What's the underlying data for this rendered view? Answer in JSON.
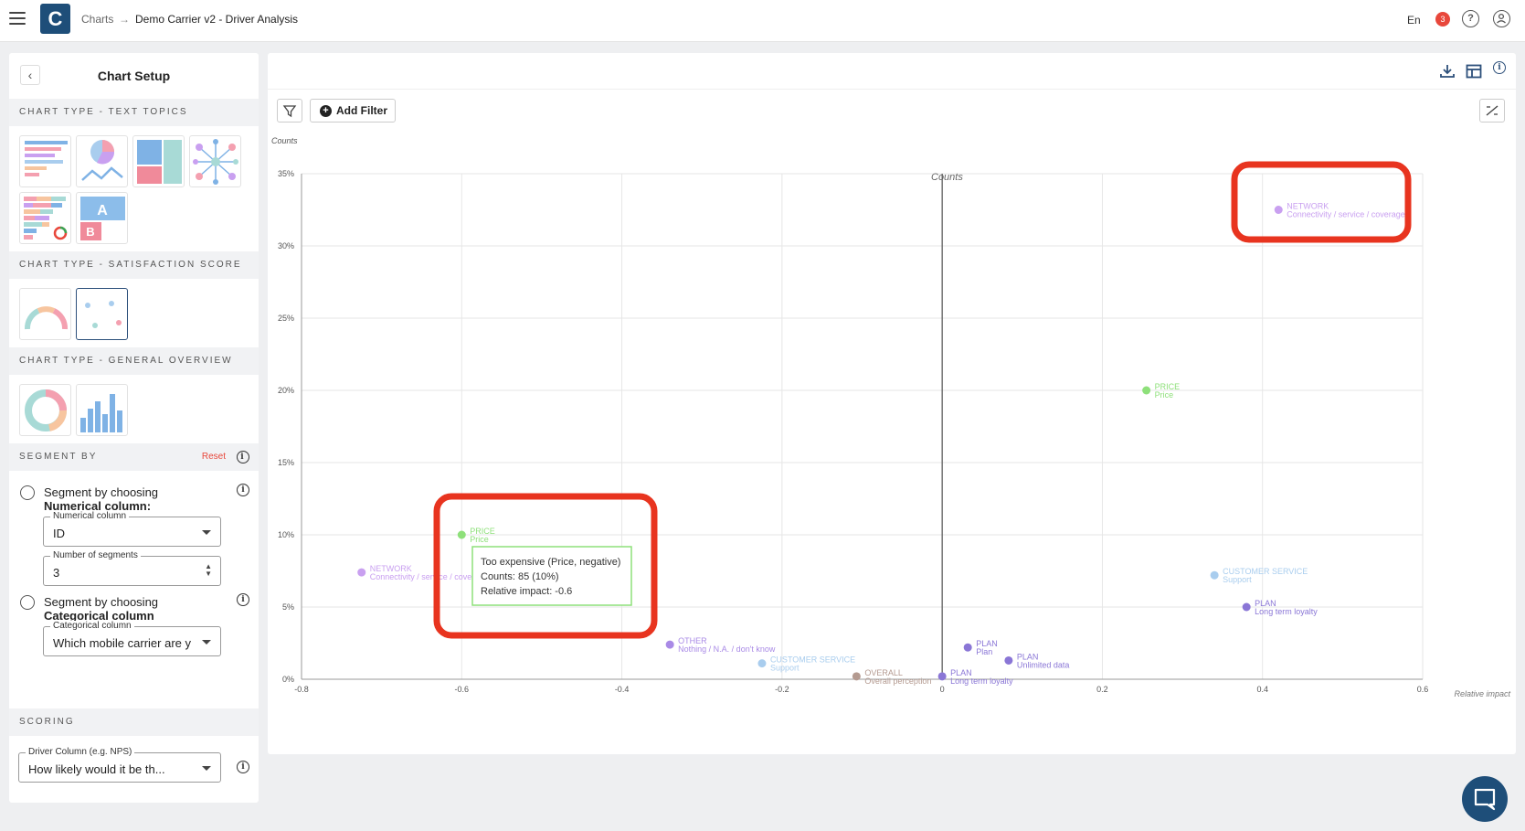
{
  "topbar": {
    "logo_letter": "C",
    "breadcrumb_root": "Charts",
    "breadcrumb_sep": "→",
    "breadcrumb_current": "Demo Carrier v2 - Driver Analysis",
    "language": "En",
    "notification_count": "3"
  },
  "panel": {
    "title": "Chart Setup",
    "section_text_topics": "CHART TYPE - TEXT TOPICS",
    "section_satisfaction": "CHART TYPE - SATISFACTION SCORE",
    "section_general": "CHART TYPE - GENERAL OVERVIEW",
    "section_segment": "SEGMENT BY",
    "reset_label": "Reset",
    "segment_numerical_line1": "Segment by choosing",
    "segment_numerical_line2": "Numerical column:",
    "numerical_column_label": "Numerical column",
    "numerical_column_value": "ID",
    "segments_label": "Number of segments",
    "segments_value": "3",
    "segment_categorical_line1": "Segment by choosing",
    "segment_categorical_line2": "Categorical column",
    "categorical_column_label": "Categorical column",
    "categorical_column_value": "Which mobile carrier are y",
    "section_scoring": "SCORING",
    "driver_column_label": "Driver Column (e.g. NPS)",
    "driver_column_value": "How likely would it be th..."
  },
  "card": {
    "add_filter_label": "Add Filter"
  },
  "chart_data": {
    "type": "scatter",
    "ylabel": "Counts",
    "xlabel": "Relative impact",
    "center_axis_label": "Counts",
    "xlim": [
      -0.8,
      0.6
    ],
    "ylim": [
      0,
      35
    ],
    "x_ticks": [
      "-0.8",
      "-0.6",
      "-0.4",
      "-0.2",
      "0",
      "0.2",
      "0.4",
      "0.6"
    ],
    "y_ticks": [
      "0%",
      "5%",
      "10%",
      "15%",
      "20%",
      "25%",
      "30%",
      "35%"
    ],
    "points": [
      {
        "x": 0.42,
        "y": 32.5,
        "category": "NETWORK",
        "topic": "Connectivity / service / coverage",
        "color": "#c9a0f0"
      },
      {
        "x": 0.255,
        "y": 20.0,
        "category": "PRICE",
        "topic": "Price",
        "color": "#8ee07a"
      },
      {
        "x": -0.6,
        "y": 10.0,
        "category": "PRICE",
        "topic": "Price",
        "color": "#8ee07a"
      },
      {
        "x": -0.725,
        "y": 7.4,
        "category": "NETWORK",
        "topic": "Connectivity / service / coverage",
        "color": "#c9a0f0"
      },
      {
        "x": 0.34,
        "y": 7.2,
        "category": "CUSTOMER SERVICE",
        "topic": "Support",
        "color": "#a9cdee"
      },
      {
        "x": 0.38,
        "y": 5.0,
        "category": "PLAN",
        "topic": "Long term loyalty",
        "color": "#8a76d6"
      },
      {
        "x": -0.34,
        "y": 2.4,
        "category": "OTHER",
        "topic": "Nothing / N.A. / don't know",
        "color": "#a98ae6"
      },
      {
        "x": 0.032,
        "y": 2.2,
        "category": "PLAN",
        "topic": "Plan",
        "color": "#8a76d6"
      },
      {
        "x": 0.083,
        "y": 1.3,
        "category": "PLAN",
        "topic": "Unlimited data",
        "color": "#8a76d6"
      },
      {
        "x": -0.225,
        "y": 1.1,
        "category": "CUSTOMER SERVICE",
        "topic": "Support",
        "color": "#a9cdee"
      },
      {
        "x": -0.107,
        "y": 0.2,
        "category": "OVERALL",
        "topic": "Overall perception",
        "color": "#b49a90"
      },
      {
        "x": 0.0,
        "y": 0.2,
        "category": "PLAN",
        "topic": "Long term loyalty",
        "color": "#8a76d6"
      }
    ]
  },
  "tooltip": {
    "line1": "Too expensive (Price, negative)",
    "line2": "Counts: 85 (10%)",
    "line3": "Relative impact: -0.6"
  }
}
